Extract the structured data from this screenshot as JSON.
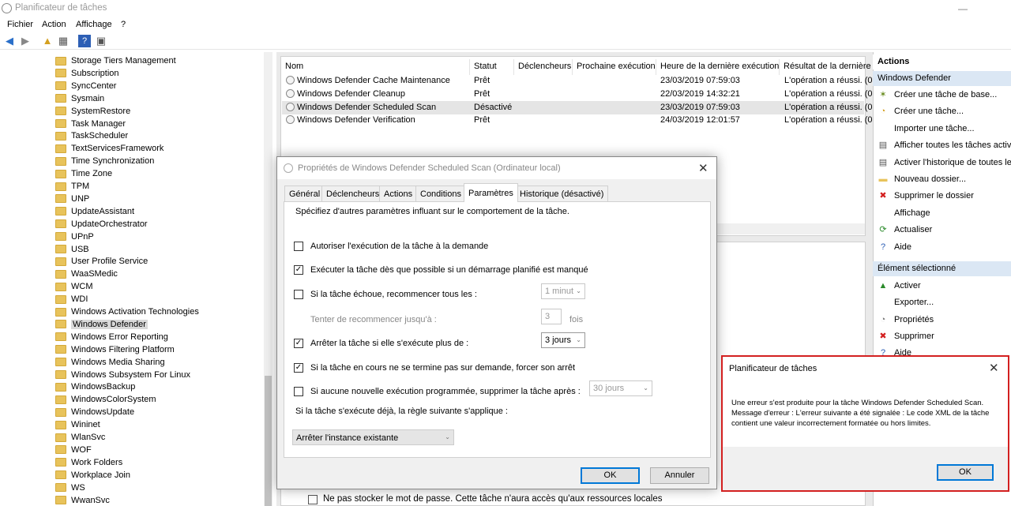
{
  "window": {
    "title": "Planificateur de tâches",
    "minimize": "—"
  },
  "menu": [
    "Fichier",
    "Action",
    "Affichage",
    "?"
  ],
  "tree": {
    "items": [
      "Storage Tiers Management",
      "Subscription",
      "SyncCenter",
      "Sysmain",
      "SystemRestore",
      "Task Manager",
      "TaskScheduler",
      "TextServicesFramework",
      "Time Synchronization",
      "Time Zone",
      "TPM",
      "UNP",
      "UpdateAssistant",
      "UpdateOrchestrator",
      "UPnP",
      "USB",
      "User Profile Service",
      "WaaSMedic",
      "WCM",
      "WDI",
      "Windows Activation Technologies",
      "Windows Defender",
      "Windows Error Reporting",
      "Windows Filtering Platform",
      "Windows Media Sharing",
      "Windows Subsystem For Linux",
      "WindowsBackup",
      "WindowsColorSystem",
      "WindowsUpdate",
      "Wininet",
      "WlanSvc",
      "WOF",
      "Work Folders",
      "Workplace Join",
      "WS",
      "WwanSvc"
    ],
    "selected": "Windows Defender"
  },
  "list": {
    "columns": [
      "Nom",
      "Statut",
      "Déclencheurs",
      "Prochaine exécution",
      "Heure de la dernière exécution",
      "Résultat de la dernière"
    ],
    "rows": [
      {
        "name": "Windows Defender Cache Maintenance",
        "status": "Prêt",
        "last": "23/03/2019 07:59:03",
        "result": "L'opération a réussi. (0"
      },
      {
        "name": "Windows Defender Cleanup",
        "status": "Prêt",
        "last": "22/03/2019 14:32:21",
        "result": "L'opération a réussi. (0"
      },
      {
        "name": "Windows Defender Scheduled Scan",
        "status": "Désactivé",
        "last": "23/03/2019 07:59:03",
        "result": "L'opération a réussi. (0"
      },
      {
        "name": "Windows Defender Verification",
        "status": "Prêt",
        "last": "24/03/2019 12:01:57",
        "result": "L'opération a réussi. (0"
      }
    ]
  },
  "lower": {
    "checkbox_label": "Ne pas stocker le mot de passe. Cette tâche n'aura accès qu'aux ressources locales"
  },
  "actions": {
    "header": "Actions",
    "section1": "Windows Defender",
    "items1": [
      "Créer une tâche de base...",
      "Créer une tâche...",
      "Importer une tâche...",
      "Afficher toutes les tâches actives",
      "Activer l'historique de toutes les",
      "Nouveau dossier...",
      "Supprimer le dossier",
      "Affichage",
      "Actualiser",
      "Aide"
    ],
    "section2": "Élément sélectionné",
    "items2": [
      "Activer",
      "Exporter...",
      "Propriétés",
      "Supprimer",
      "Aide"
    ]
  },
  "dialog": {
    "title": "Propriétés de Windows Defender Scheduled Scan (Ordinateur local)",
    "tabs": [
      "Général",
      "Déclencheurs",
      "Actions",
      "Conditions",
      "Paramètres",
      "Historique (désactivé)"
    ],
    "intro": "Spécifiez d'autres paramètres influant sur le comportement de la tâche.",
    "opt1": "Autoriser l'exécution de la tâche à la demande",
    "opt2": "Exécuter la tâche dès que possible si un démarrage planifié est manqué",
    "opt3": "Si la tâche échoue, recommencer tous les :",
    "opt3_value": "1 minut",
    "retry_label": "Tenter de recommencer jusqu'à :",
    "retry_value": "3",
    "retry_unit": "fois",
    "opt4": "Arrêter la tâche si elle s'exécute plus de :",
    "opt4_value": "3 jours",
    "opt5": "Si la tâche en cours ne se termine pas sur demande, forcer son arrêt",
    "opt6": "Si aucune nouvelle exécution programmée, supprimer la tâche après :",
    "opt6_value": "30 jours",
    "rule_label": "Si la tâche s'exécute déjà, la règle suivante s'applique :",
    "rule_value": "Arrêter l'instance existante",
    "ok": "OK",
    "cancel": "Annuler",
    "check": "✓"
  },
  "error": {
    "title": "Planificateur de tâches",
    "line1": "Une erreur s'est produite pour la tâche Windows Defender Scheduled Scan.",
    "line2": "Message d'erreur : L'erreur suivante a été signalée : Le code XML de la tâche contient une valeur incorrectement formatée ou hors limites.",
    "ok": "OK"
  },
  "colors": {
    "accent": "#0078d7",
    "error_border": "#d32020",
    "action_header": "#dbe7f4"
  }
}
